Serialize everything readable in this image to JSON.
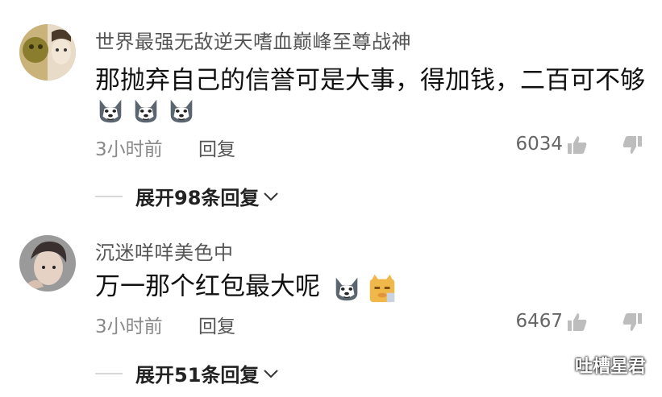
{
  "comments": [
    {
      "username": "世界最强无敌逆天嗜血巅峰至尊战神",
      "text": "那抛弃自己的信誉可是大事，得加钱，二百可不够",
      "emojis": [
        "husky-emoji",
        "husky-emoji",
        "husky-emoji"
      ],
      "time": "3小时前",
      "reply_label": "回复",
      "likes": "6034",
      "expand_label": "展开98条回复"
    },
    {
      "username": "沉迷咩咩美色中",
      "text": "万一那个红包最大呢",
      "emojis": [
        "husky-emoji",
        "doge-cat-emoji"
      ],
      "time": "3小时前",
      "reply_label": "回复",
      "likes": "6467",
      "expand_label": "展开51条回复"
    }
  ],
  "watermark": {
    "text": "吐槽星君",
    "icon": "wechat-icon"
  },
  "colors": {
    "meta": "#8a8a8a",
    "text": "#111111",
    "username": "#555555"
  }
}
